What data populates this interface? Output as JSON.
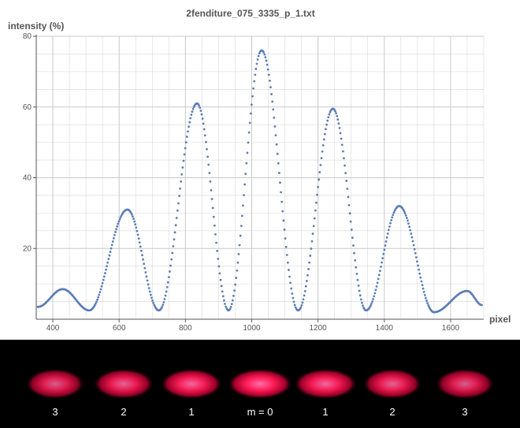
{
  "chart_data": {
    "type": "scatter",
    "title": "2fenditure_075_3335_p_1.txt",
    "xlabel": "pixel",
    "ylabel": "intensity (%)",
    "xlim": [
      350,
      1700
    ],
    "ylim": [
      0,
      80
    ],
    "x_ticks": [
      400,
      600,
      800,
      1000,
      1200,
      1400,
      1600
    ],
    "y_ticks": [
      20,
      40,
      60,
      80
    ],
    "grid": true,
    "marker_color": "#5b7db5",
    "peaks": [
      {
        "x": 355,
        "y": 3.5
      },
      {
        "x": 430,
        "y": 8.5
      },
      {
        "x": 510,
        "y": 2.5
      },
      {
        "x": 625,
        "y": 31
      },
      {
        "x": 720,
        "y": 2.5
      },
      {
        "x": 835,
        "y": 61
      },
      {
        "x": 930,
        "y": 2.5
      },
      {
        "x": 1030,
        "y": 76
      },
      {
        "x": 1140,
        "y": 2.5
      },
      {
        "x": 1245,
        "y": 59.5
      },
      {
        "x": 1345,
        "y": 2.5
      },
      {
        "x": 1445,
        "y": 32
      },
      {
        "x": 1550,
        "y": 2
      },
      {
        "x": 1650,
        "y": 8
      },
      {
        "x": 1695,
        "y": 4
      }
    ]
  },
  "fringe_labels": [
    "3",
    "2",
    "1",
    "m = 0",
    "1",
    "2",
    "3"
  ],
  "colors": {
    "fringe_strip_bg": "#000000",
    "fringe_color": "#ff1a55",
    "axis_text": "#555555",
    "grid": "#c8c8c8"
  }
}
